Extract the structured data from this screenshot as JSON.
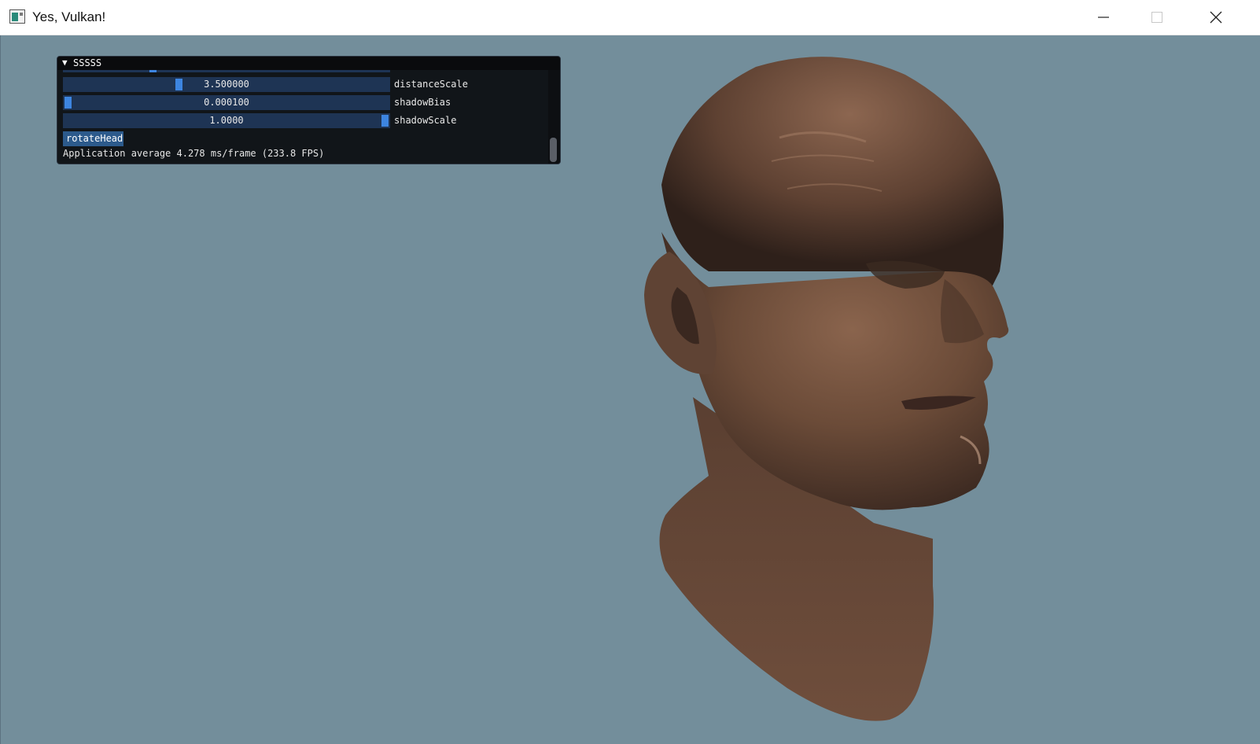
{
  "window": {
    "title": "Yes, Vulkan!"
  },
  "panel": {
    "title": "SSSSS",
    "sliders": [
      {
        "value_text": "3.500000",
        "label": "distanceScale",
        "fraction": 0.35
      },
      {
        "value_text": "0.000100",
        "label": "shadowBias",
        "fraction": 0.0
      },
      {
        "value_text": "1.0000",
        "label": "shadowScale",
        "fraction": 1.0
      }
    ],
    "button_label": "rotateHead",
    "fps_text": "Application average 4.278 ms/frame (233.8 FPS)"
  },
  "colors": {
    "viewport_background": "#738e9b",
    "slider_track": "#1e3454",
    "slider_grab": "#3d85e0",
    "button": "#2c5a8c",
    "skin": "#6b4b38"
  },
  "icons": [
    "app-icon",
    "minimize-icon",
    "maximize-icon",
    "close-icon",
    "collapse-arrow-icon"
  ]
}
